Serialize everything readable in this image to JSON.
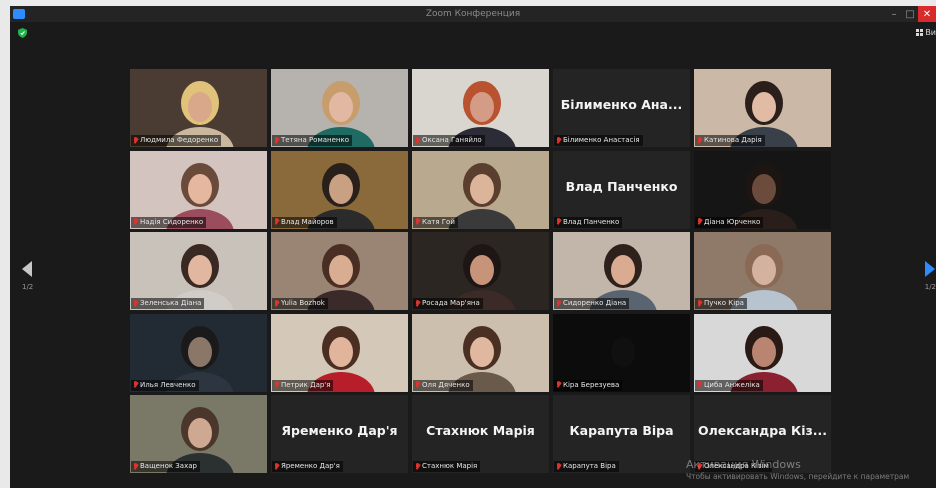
{
  "window": {
    "title": "Zoom Конференция",
    "min_glyph": "–",
    "max_glyph": "□",
    "close_glyph": "✕",
    "view_label": "Ви"
  },
  "navigation": {
    "left_page": "1/2",
    "right_page": "1/2"
  },
  "participants": [
    {
      "name": "Людмила Федоренко",
      "video": true,
      "bg": "#4a3c32",
      "skin": "#d9a88a",
      "hair": "#e0c27a",
      "shirt": "#c9b79e"
    },
    {
      "name": "Тетяна Романенко",
      "video": true,
      "bg": "#b6b2ad",
      "skin": "#e2b8a2",
      "hair": "#c79d6c",
      "shirt": "#1f6b63"
    },
    {
      "name": "Оксана Ганяйло",
      "video": true,
      "active": true,
      "bg": "#d9d6cf",
      "skin": "#d49b86",
      "hair": "#b8522f",
      "shirt": "#2c2c36"
    },
    {
      "name": "Білименко Анастасія",
      "video": false,
      "display_name": "Білименко Ана..."
    },
    {
      "name": "Катинова Дарія",
      "video": true,
      "bg": "#cbb8a6",
      "skin": "#e2bba4",
      "hair": "#2b1f1c",
      "shirt": "#394049"
    },
    {
      "name": "Надія Сидоренко",
      "video": true,
      "bg": "#d4c4c0",
      "skin": "#e4b79e",
      "hair": "#6a4a3a",
      "shirt": "#9b4d5d"
    },
    {
      "name": "Влад Майоров",
      "video": true,
      "bg": "#8a6a3b",
      "skin": "#c9a082",
      "hair": "#2a201b",
      "shirt": "#2b2b2b"
    },
    {
      "name": "Катя Гой",
      "video": true,
      "bg": "#b9a98e",
      "skin": "#dcb49a",
      "hair": "#5a3f2e",
      "shirt": "#3a3a3a"
    },
    {
      "name": "Влад Панченко",
      "video": false,
      "display_name": "Влад Панченко"
    },
    {
      "name": "Діана Юрченко",
      "video": true,
      "bg": "#151515",
      "skin": "#6b4b3c",
      "hair": "#1c1512",
      "shirt": "#2a1e1a"
    },
    {
      "name": "Зеленська Діана",
      "video": true,
      "bg": "#c8c2bb",
      "skin": "#e2b7a0",
      "hair": "#3a2822",
      "shirt": "#d0ccc8"
    },
    {
      "name": "Yulia Bozhok",
      "video": true,
      "bg": "#9a8574",
      "skin": "#d8ad92",
      "hair": "#4a2e24",
      "shirt": "#3a2a2a"
    },
    {
      "name": "Росада Мар'яна",
      "video": true,
      "bg": "#2c2623",
      "skin": "#c89479",
      "hair": "#1d1614",
      "shirt": "#3b2a25"
    },
    {
      "name": "Сидоренко Діана",
      "video": true,
      "bg": "#c2b6aa",
      "skin": "#d9ab90",
      "hair": "#2e211c",
      "shirt": "#5a6470"
    },
    {
      "name": "Пучко Кіра",
      "video": true,
      "bg": "#8f7a6a",
      "skin": "#d3b2a0",
      "hair": "#8a6a55",
      "shirt": "#b7c3cf"
    },
    {
      "name": "Илья Левченко",
      "video": true,
      "bg": "#222a33",
      "skin": "#8a7768",
      "hair": "#1a1a1a",
      "shirt": "#2c3540"
    },
    {
      "name": "Петрик Дар'я",
      "video": true,
      "bg": "#d4c8b8",
      "skin": "#e1b49c",
      "hair": "#4b2e22",
      "shirt": "#b81e2a"
    },
    {
      "name": "Оля Дяченко",
      "video": true,
      "bg": "#cdbfad",
      "skin": "#e0b8a0",
      "hair": "#4a3022",
      "shirt": "#6a5a4c"
    },
    {
      "name": "Кіра Березуева",
      "video": true,
      "bg": "#0c0c0c",
      "skin": "#101010",
      "hair": "#0c0c0c",
      "shirt": "#0c0c0c"
    },
    {
      "name": "Циба Анжеліка",
      "video": true,
      "bg": "#d8d8d8",
      "skin": "#b98570",
      "hair": "#2a1a16",
      "shirt": "#8b2030"
    },
    {
      "name": "Ващенок Захар",
      "video": true,
      "bg": "#7a7866",
      "skin": "#cfa891",
      "hair": "#4a362b",
      "shirt": "#2b3030"
    },
    {
      "name": "Яременко Дар'я",
      "video": false,
      "display_name": "Яременко Дар'я"
    },
    {
      "name": "Стахнюк Марія",
      "video": false,
      "display_name": "Стахнюк Марія"
    },
    {
      "name": "Карапута Віра",
      "video": false,
      "display_name": "Карапута Віра"
    },
    {
      "name": "Олександра Кізім",
      "video": false,
      "display_name": "Олександра Кіз..."
    }
  ],
  "watermark": {
    "line1": "Активация Windows",
    "line2": "Чтобы активировать Windows, перейдите к параметрам"
  }
}
